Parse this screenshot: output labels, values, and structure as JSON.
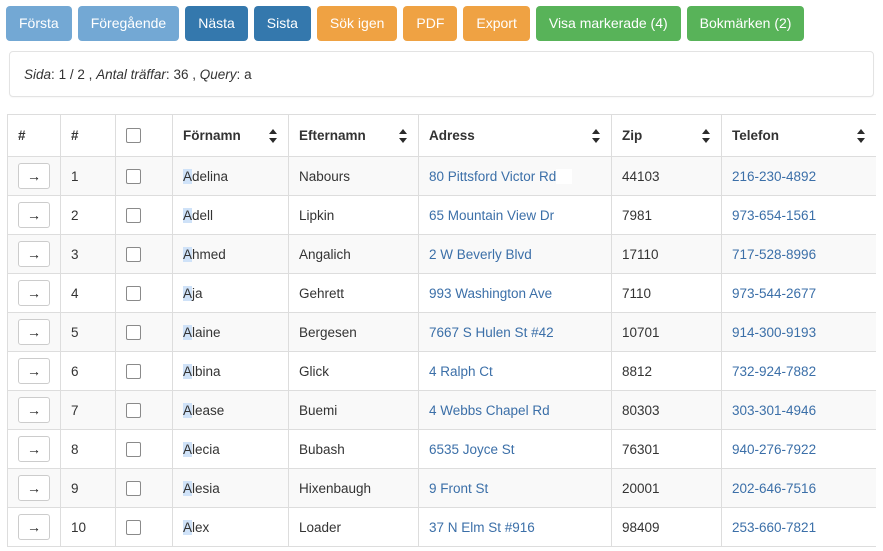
{
  "toolbar": {
    "buttons": [
      {
        "label": "Första",
        "style": "light-blue",
        "name": "first-page-button"
      },
      {
        "label": "Föregående",
        "style": "light-blue",
        "name": "previous-page-button"
      },
      {
        "label": "Nästa",
        "style": "blue",
        "name": "next-page-button"
      },
      {
        "label": "Sista",
        "style": "blue",
        "name": "last-page-button"
      },
      {
        "label": "Sök igen",
        "style": "orange",
        "name": "search-again-button"
      },
      {
        "label": "PDF",
        "style": "orange",
        "name": "pdf-button"
      },
      {
        "label": "Export",
        "style": "orange",
        "name": "export-button"
      },
      {
        "label": "Visa markerade (4)",
        "style": "green",
        "name": "show-selected-button"
      },
      {
        "label": "Bokmärken (2)",
        "style": "green",
        "name": "bookmarks-button"
      }
    ]
  },
  "info": {
    "page_label": "Sida",
    "page_value": "1 / 2",
    "hits_label": "Antal träffar",
    "hits_value": "36",
    "query_label": "Query",
    "query_value": "a",
    "separator": ",",
    "colon": ":"
  },
  "table": {
    "headers": {
      "go": "#",
      "num": "#",
      "first_name": "Förnamn",
      "last_name": "Efternamn",
      "address": "Adress",
      "zip": "Zip",
      "phone": "Telefon"
    },
    "go_icon": "→",
    "rows": [
      {
        "num": "1",
        "first_hl": "A",
        "first_rest": "delina",
        "last": "Nabours",
        "address": "80 Pittsford Victor Rd",
        "address_trailing_box": true,
        "zip": "44103",
        "phone": "216-230-4892"
      },
      {
        "num": "2",
        "first_hl": "A",
        "first_rest": "dell",
        "last": "Lipkin",
        "address": "65 Mountain View Dr",
        "address_trailing_box": false,
        "zip": "7981",
        "phone": "973-654-1561"
      },
      {
        "num": "3",
        "first_hl": "A",
        "first_rest": "hmed",
        "last": "Angalich",
        "address": "2 W Beverly Blvd",
        "address_trailing_box": false,
        "zip": "17110",
        "phone": "717-528-8996"
      },
      {
        "num": "4",
        "first_hl": "A",
        "first_rest": "ja",
        "last": "Gehrett",
        "address": "993 Washington Ave",
        "address_trailing_box": false,
        "zip": "7110",
        "phone": "973-544-2677"
      },
      {
        "num": "5",
        "first_hl": "A",
        "first_rest": "laine",
        "last": "Bergesen",
        "address": "7667 S Hulen St #42",
        "address_trailing_box": false,
        "zip": "10701",
        "phone": "914-300-9193"
      },
      {
        "num": "6",
        "first_hl": "A",
        "first_rest": "lbina",
        "last": "Glick",
        "address": "4 Ralph Ct",
        "address_trailing_box": false,
        "zip": "8812",
        "phone": "732-924-7882"
      },
      {
        "num": "7",
        "first_hl": "A",
        "first_rest": "lease",
        "last": "Buemi",
        "address": "4 Webbs Chapel Rd",
        "address_trailing_box": false,
        "zip": "80303",
        "phone": "303-301-4946"
      },
      {
        "num": "8",
        "first_hl": "A",
        "first_rest": "lecia",
        "last": "Bubash",
        "address": "6535 Joyce St",
        "address_trailing_box": false,
        "zip": "76301",
        "phone": "940-276-7922"
      },
      {
        "num": "9",
        "first_hl": "A",
        "first_rest": "lesia",
        "last": "Hixenbaugh",
        "address": "9 Front St",
        "address_trailing_box": false,
        "zip": "20001",
        "phone": "202-646-7516"
      },
      {
        "num": "10",
        "first_hl": "A",
        "first_rest": "lex",
        "last": "Loader",
        "address": "37 N Elm St #916",
        "address_trailing_box": false,
        "zip": "98409",
        "phone": "253-660-7821"
      }
    ]
  },
  "colors": {
    "light_blue": "#73a8d4",
    "blue": "#3478ad",
    "orange": "#efa243",
    "green": "#58b359",
    "link": "#3b6fa8",
    "highlight": "#cfe2f8",
    "row_stripe": "#f9f9f9",
    "border": "#dddddd"
  }
}
